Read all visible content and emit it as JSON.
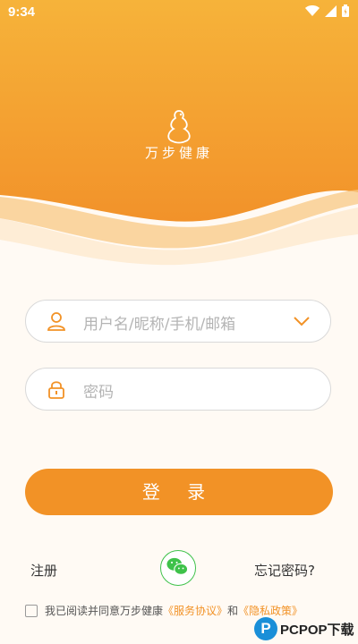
{
  "colors": {
    "accent": "#f29226",
    "wechat": "#3ec24a",
    "placeholder": "#b4b4b4"
  },
  "status_bar": {
    "time": "9:34",
    "icons": [
      "wifi-icon",
      "signal-icon",
      "battery-icon"
    ]
  },
  "app": {
    "name": "万步健康",
    "logo_icon": "gourd-logo-icon"
  },
  "form": {
    "username": {
      "placeholder": "用户名/昵称/手机/邮箱",
      "icon": "user-icon",
      "dropdown_icon": "chevron-down-icon"
    },
    "password": {
      "placeholder": "密码",
      "icon": "lock-icon"
    },
    "login_label": "登 录"
  },
  "links": {
    "register": "注册",
    "forgot": "忘记密码?",
    "wechat_icon": "wechat-icon"
  },
  "agreement": {
    "text": "我已阅读并同意万步健康",
    "terms": "《服务协议》",
    "and": "和",
    "privacy": "《隐私政策》"
  },
  "watermark": {
    "mark": "P",
    "text": "PCPOP下载"
  }
}
